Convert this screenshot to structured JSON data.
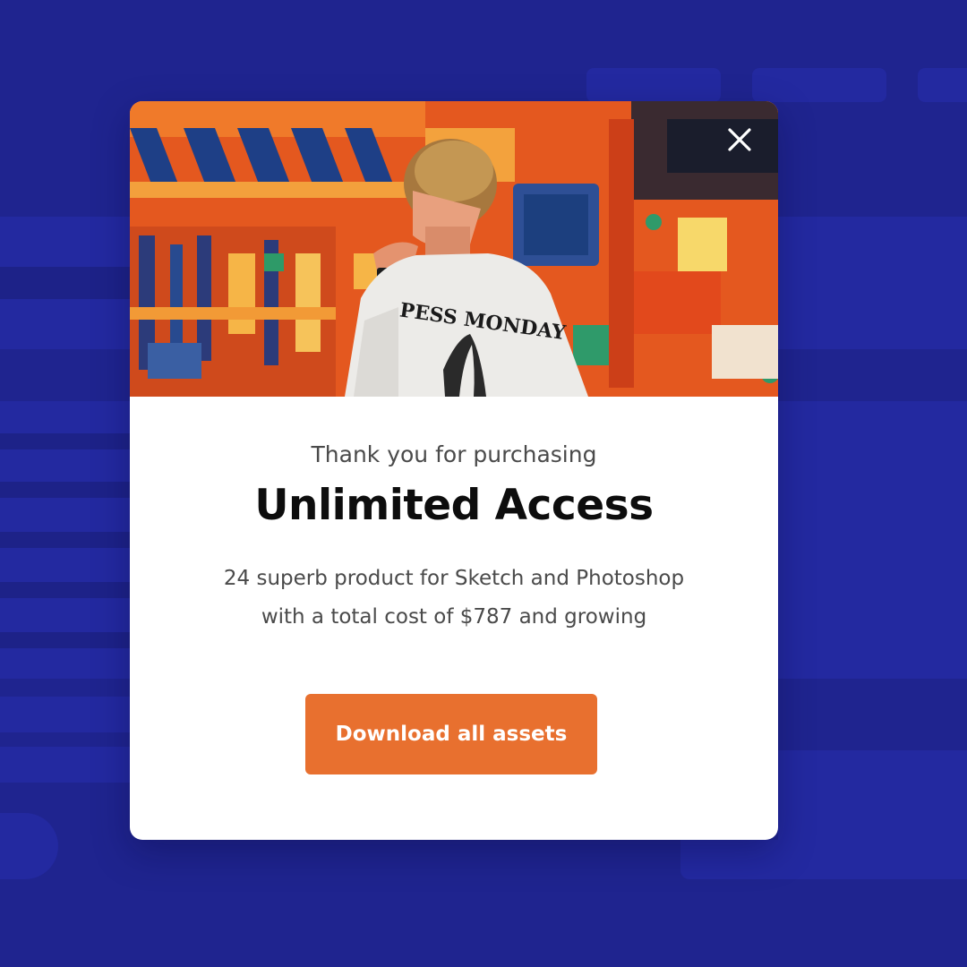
{
  "modal": {
    "subtitle": "Thank you for purchasing",
    "title": "Unlimited Access",
    "description_line1": "24 superb product for Sketch and Photoshop",
    "description_line2": "with a total cost of $787 and growing",
    "cta_label": "Download all assets",
    "close_icon": "close-icon",
    "hero_image": "graffiti-wall-photo",
    "hero_lettering": "PESS MONDAY"
  },
  "colors": {
    "background": "#1f248f",
    "modal_bg": "#ffffff",
    "accent": "#e8702f",
    "title_text": "#0d0d0d",
    "body_text": "#4a4a4a"
  }
}
